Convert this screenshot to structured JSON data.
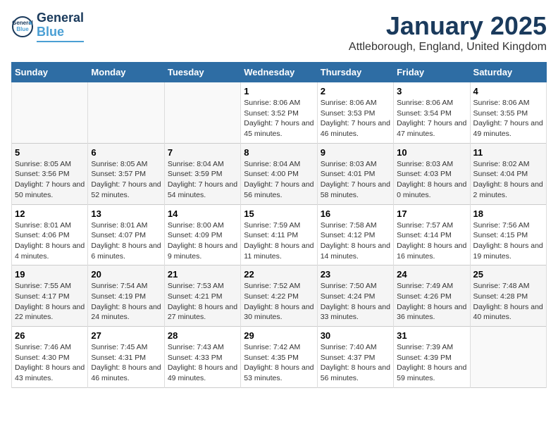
{
  "logo": {
    "line1": "General",
    "line2": "Blue"
  },
  "title": "January 2025",
  "subtitle": "Attleborough, England, United Kingdom",
  "weekdays": [
    "Sunday",
    "Monday",
    "Tuesday",
    "Wednesday",
    "Thursday",
    "Friday",
    "Saturday"
  ],
  "weeks": [
    [
      {
        "day": "",
        "info": ""
      },
      {
        "day": "",
        "info": ""
      },
      {
        "day": "",
        "info": ""
      },
      {
        "day": "1",
        "info": "Sunrise: 8:06 AM\nSunset: 3:52 PM\nDaylight: 7 hours and 45 minutes."
      },
      {
        "day": "2",
        "info": "Sunrise: 8:06 AM\nSunset: 3:53 PM\nDaylight: 7 hours and 46 minutes."
      },
      {
        "day": "3",
        "info": "Sunrise: 8:06 AM\nSunset: 3:54 PM\nDaylight: 7 hours and 47 minutes."
      },
      {
        "day": "4",
        "info": "Sunrise: 8:06 AM\nSunset: 3:55 PM\nDaylight: 7 hours and 49 minutes."
      }
    ],
    [
      {
        "day": "5",
        "info": "Sunrise: 8:05 AM\nSunset: 3:56 PM\nDaylight: 7 hours and 50 minutes."
      },
      {
        "day": "6",
        "info": "Sunrise: 8:05 AM\nSunset: 3:57 PM\nDaylight: 7 hours and 52 minutes."
      },
      {
        "day": "7",
        "info": "Sunrise: 8:04 AM\nSunset: 3:59 PM\nDaylight: 7 hours and 54 minutes."
      },
      {
        "day": "8",
        "info": "Sunrise: 8:04 AM\nSunset: 4:00 PM\nDaylight: 7 hours and 56 minutes."
      },
      {
        "day": "9",
        "info": "Sunrise: 8:03 AM\nSunset: 4:01 PM\nDaylight: 7 hours and 58 minutes."
      },
      {
        "day": "10",
        "info": "Sunrise: 8:03 AM\nSunset: 4:03 PM\nDaylight: 8 hours and 0 minutes."
      },
      {
        "day": "11",
        "info": "Sunrise: 8:02 AM\nSunset: 4:04 PM\nDaylight: 8 hours and 2 minutes."
      }
    ],
    [
      {
        "day": "12",
        "info": "Sunrise: 8:01 AM\nSunset: 4:06 PM\nDaylight: 8 hours and 4 minutes."
      },
      {
        "day": "13",
        "info": "Sunrise: 8:01 AM\nSunset: 4:07 PM\nDaylight: 8 hours and 6 minutes."
      },
      {
        "day": "14",
        "info": "Sunrise: 8:00 AM\nSunset: 4:09 PM\nDaylight: 8 hours and 9 minutes."
      },
      {
        "day": "15",
        "info": "Sunrise: 7:59 AM\nSunset: 4:11 PM\nDaylight: 8 hours and 11 minutes."
      },
      {
        "day": "16",
        "info": "Sunrise: 7:58 AM\nSunset: 4:12 PM\nDaylight: 8 hours and 14 minutes."
      },
      {
        "day": "17",
        "info": "Sunrise: 7:57 AM\nSunset: 4:14 PM\nDaylight: 8 hours and 16 minutes."
      },
      {
        "day": "18",
        "info": "Sunrise: 7:56 AM\nSunset: 4:15 PM\nDaylight: 8 hours and 19 minutes."
      }
    ],
    [
      {
        "day": "19",
        "info": "Sunrise: 7:55 AM\nSunset: 4:17 PM\nDaylight: 8 hours and 22 minutes."
      },
      {
        "day": "20",
        "info": "Sunrise: 7:54 AM\nSunset: 4:19 PM\nDaylight: 8 hours and 24 minutes."
      },
      {
        "day": "21",
        "info": "Sunrise: 7:53 AM\nSunset: 4:21 PM\nDaylight: 8 hours and 27 minutes."
      },
      {
        "day": "22",
        "info": "Sunrise: 7:52 AM\nSunset: 4:22 PM\nDaylight: 8 hours and 30 minutes."
      },
      {
        "day": "23",
        "info": "Sunrise: 7:50 AM\nSunset: 4:24 PM\nDaylight: 8 hours and 33 minutes."
      },
      {
        "day": "24",
        "info": "Sunrise: 7:49 AM\nSunset: 4:26 PM\nDaylight: 8 hours and 36 minutes."
      },
      {
        "day": "25",
        "info": "Sunrise: 7:48 AM\nSunset: 4:28 PM\nDaylight: 8 hours and 40 minutes."
      }
    ],
    [
      {
        "day": "26",
        "info": "Sunrise: 7:46 AM\nSunset: 4:30 PM\nDaylight: 8 hours and 43 minutes."
      },
      {
        "day": "27",
        "info": "Sunrise: 7:45 AM\nSunset: 4:31 PM\nDaylight: 8 hours and 46 minutes."
      },
      {
        "day": "28",
        "info": "Sunrise: 7:43 AM\nSunset: 4:33 PM\nDaylight: 8 hours and 49 minutes."
      },
      {
        "day": "29",
        "info": "Sunrise: 7:42 AM\nSunset: 4:35 PM\nDaylight: 8 hours and 53 minutes."
      },
      {
        "day": "30",
        "info": "Sunrise: 7:40 AM\nSunset: 4:37 PM\nDaylight: 8 hours and 56 minutes."
      },
      {
        "day": "31",
        "info": "Sunrise: 7:39 AM\nSunset: 4:39 PM\nDaylight: 8 hours and 59 minutes."
      },
      {
        "day": "",
        "info": ""
      }
    ]
  ]
}
